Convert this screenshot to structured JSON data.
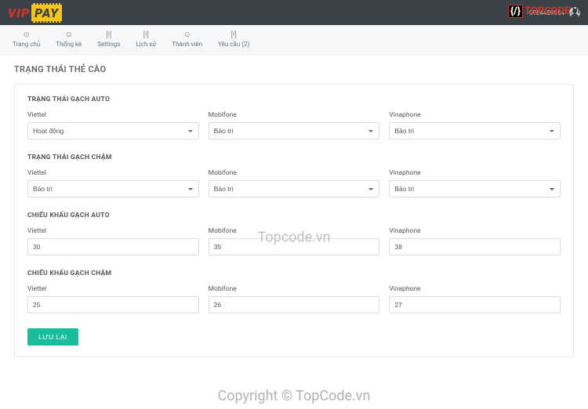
{
  "header": {
    "logo_vip": "VIP",
    "logo_pay": "PAY",
    "user_phone": "0984459954"
  },
  "nav": {
    "items": [
      {
        "icon": "⊙",
        "label": "Trang chủ"
      },
      {
        "icon": "⊙",
        "label": "Thống kê"
      },
      {
        "icon": "[!]",
        "label": "Settings"
      },
      {
        "icon": "[!]",
        "label": "Lịch sử"
      },
      {
        "icon": "⊙",
        "label": "Thành viên"
      },
      {
        "icon": "[!]",
        "label": "Yêu cầu (2)"
      }
    ]
  },
  "page": {
    "title": "TRẠNG THÁI THẺ CÀO"
  },
  "sections": {
    "auto_status": {
      "title": "TRẠNG THÁI GẠCH AUTO",
      "fields": {
        "viettel": {
          "label": "Viettel",
          "value": "Hoạt động"
        },
        "mobifone": {
          "label": "Mobifone",
          "value": "Bảo trì"
        },
        "vinaphone": {
          "label": "Vinaphone",
          "value": "Bảo trì"
        }
      }
    },
    "slow_status": {
      "title": "TRẠNG THÁI GẠCH CHẬM",
      "fields": {
        "viettel": {
          "label": "Viettel",
          "value": "Bảo trì"
        },
        "mobifone": {
          "label": "Mobifone",
          "value": "Bảo trì"
        },
        "vinaphone": {
          "label": "Vinaphone",
          "value": "Bảo trì"
        }
      }
    },
    "auto_discount": {
      "title": "CHIẾU KHẤU GẠCH AUTO",
      "fields": {
        "viettel": {
          "label": "Viettel",
          "value": "30"
        },
        "mobifone": {
          "label": "Mobifone",
          "value": "35"
        },
        "vinaphone": {
          "label": "Vinaphone",
          "value": "38"
        }
      }
    },
    "slow_discount": {
      "title": "CHIẾU KHẤU GẠCH CHẬM",
      "fields": {
        "viettel": {
          "label": "Viettel",
          "value": "25"
        },
        "mobifone": {
          "label": "Mobifone",
          "value": "26"
        },
        "vinaphone": {
          "label": "Vinaphone",
          "value": "27"
        }
      }
    }
  },
  "actions": {
    "save": "LƯU LẠI"
  },
  "watermark": {
    "topcode_brand": "{/} TOPCODE",
    "topcode_domain": ".VN",
    "center": "Topcode.vn",
    "bottom": "Copyright © TopCode.vn"
  }
}
